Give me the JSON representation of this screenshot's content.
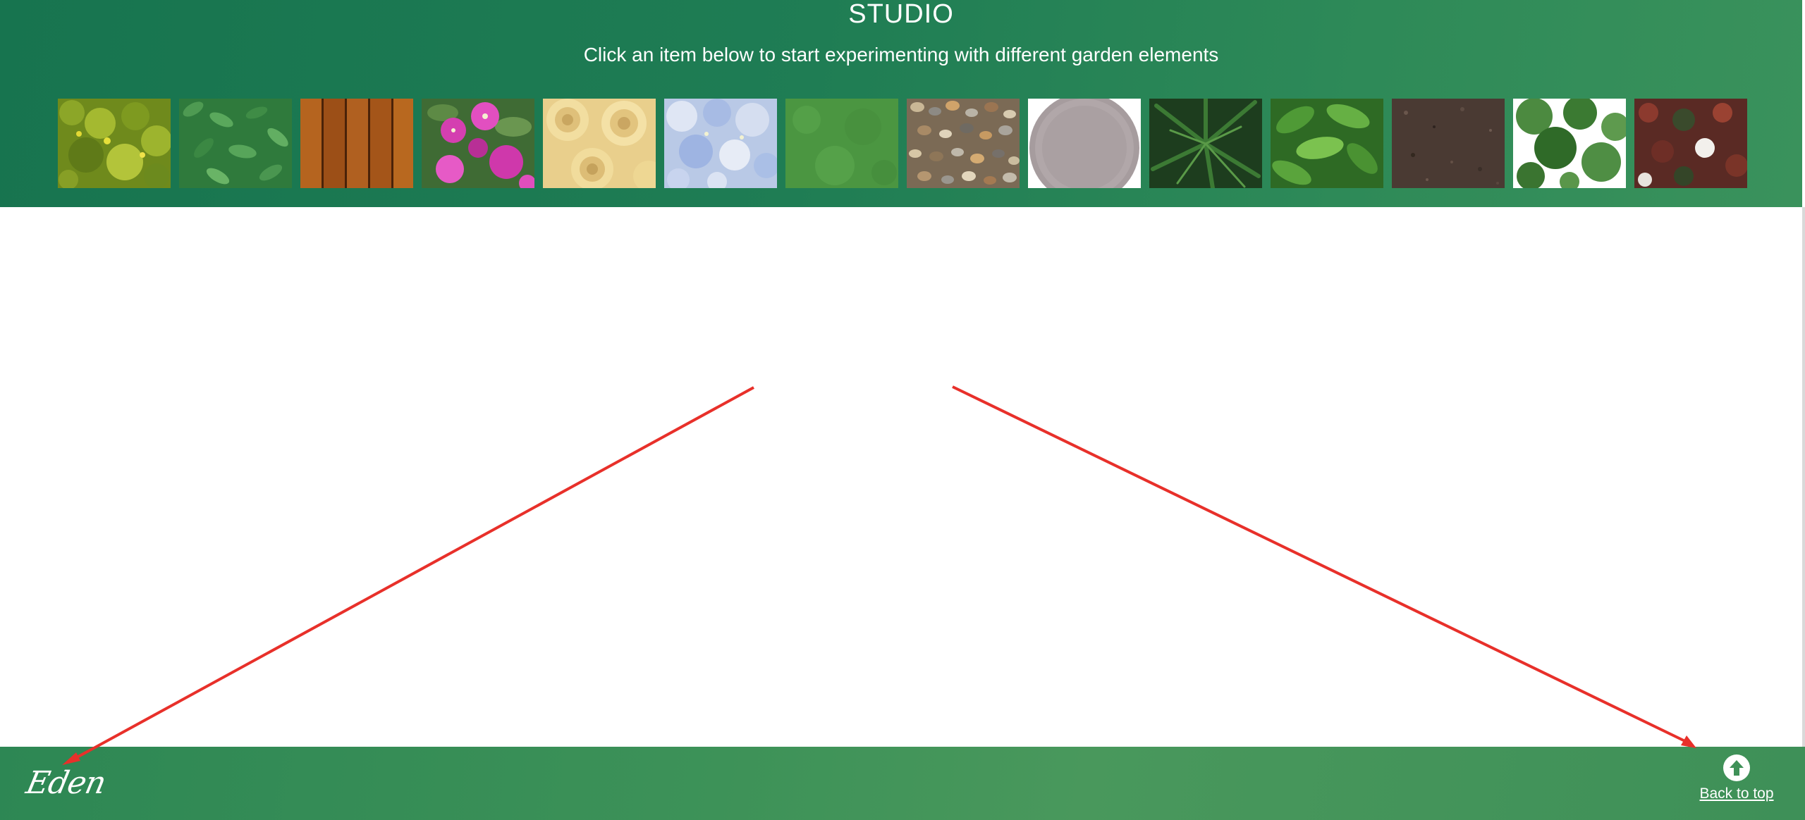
{
  "header": {
    "title": "STUDIO",
    "subtitle": "Click an item below to start experimenting with different garden elements"
  },
  "tiles": [
    {
      "name": "yellow-shrub-tile"
    },
    {
      "name": "green-hedge-tile"
    },
    {
      "name": "wood-decking-tile"
    },
    {
      "name": "bougainvillea-tile"
    },
    {
      "name": "yellow-roses-tile"
    },
    {
      "name": "blue-hydrangea-tile"
    },
    {
      "name": "lawn-grass-tile"
    },
    {
      "name": "gravel-pebbles-tile"
    },
    {
      "name": "round-stone-paver-tile"
    },
    {
      "name": "palm-fern-tile"
    },
    {
      "name": "glossy-leaf-plant-tile"
    },
    {
      "name": "soil-tile"
    },
    {
      "name": "tree-canopy-tile"
    },
    {
      "name": "red-foliage-tile"
    }
  ],
  "footer": {
    "logo": "Eden",
    "back_to_top": "Back to top",
    "back_to_top_icon": "arrow-up-circle-icon"
  },
  "colors": {
    "header_green": "#1f7d54",
    "footer_green": "#3f9158",
    "annotation_red": "#e8302a"
  }
}
